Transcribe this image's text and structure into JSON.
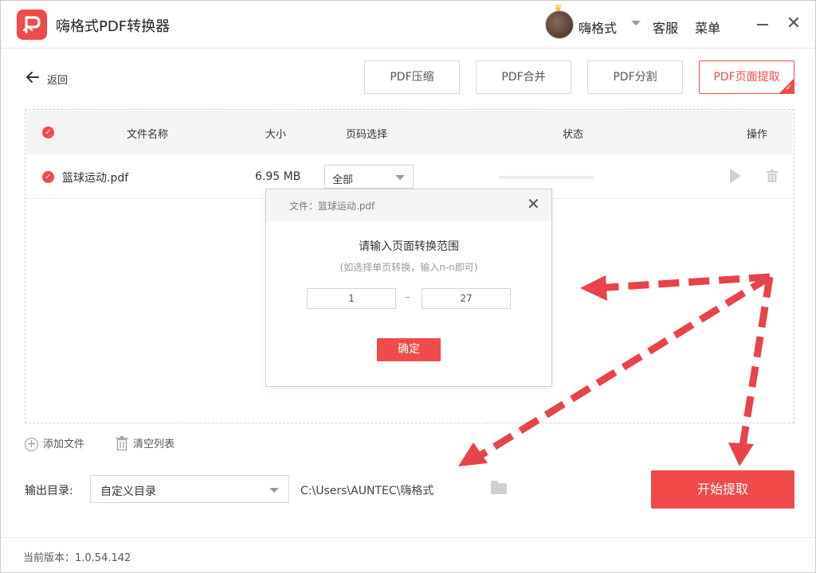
{
  "app": {
    "title": "嗨格式PDF转换器",
    "username": "嗨格式",
    "service": "客服",
    "menu": "菜单"
  },
  "toolbar": {
    "back_label": "返回",
    "tools": [
      {
        "label": "PDF压缩"
      },
      {
        "label": "PDF合并"
      },
      {
        "label": "PDF分割"
      },
      {
        "label": "PDF页面提取"
      }
    ]
  },
  "table": {
    "headers": {
      "name": "文件名称",
      "size": "大小",
      "pages": "页码选择",
      "status": "状态",
      "actions": "操作"
    },
    "rows": [
      {
        "name": "篮球运动.pdf",
        "size": "6.95 MB",
        "pages": "全部"
      }
    ]
  },
  "dialog": {
    "file_label": "文件：篮球运动.pdf",
    "title": "请输入页面转换范围",
    "hint": "(如选择单页转换，输入n-n即可)",
    "from_value": "1",
    "to_value": "27",
    "dash": "–",
    "confirm": "确定"
  },
  "bottom": {
    "add_file": "添加文件",
    "clear_list": "清空列表",
    "output_label": "输出目录:",
    "output_option": "自定义目录",
    "output_path": "C:\\Users\\AUNTEC\\嗨格式",
    "start": "开始提取"
  },
  "footer": {
    "version": "当前版本：1.0.54.142"
  },
  "colors": {
    "accent": "#f04a4a",
    "arrow": "#e8434b"
  },
  "icons": [
    "app-logo-icon",
    "crown-icon",
    "chevron-down-icon",
    "minimize-icon",
    "close-icon",
    "back-arrow-icon",
    "check-icon",
    "play-icon",
    "trash-icon",
    "add-icon",
    "folder-icon"
  ]
}
